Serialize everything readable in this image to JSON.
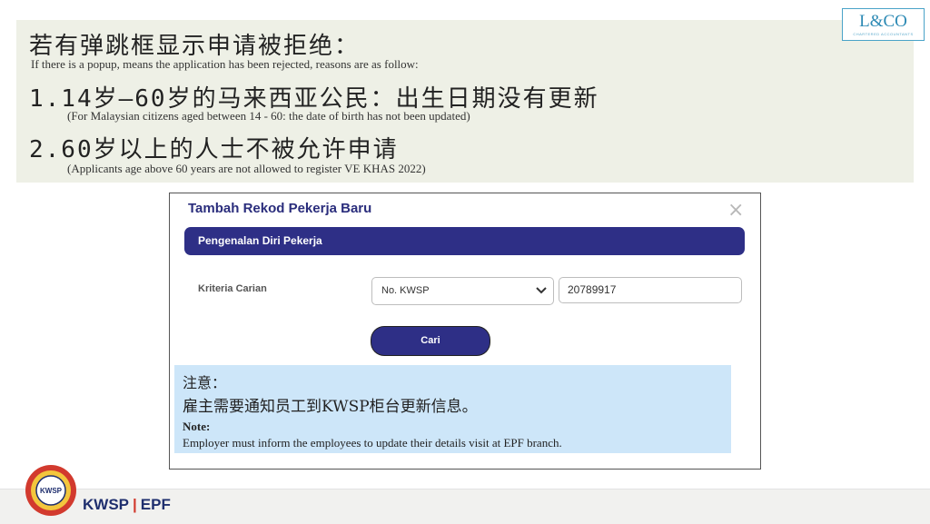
{
  "banner": {
    "title_zh": "若有弹跳框显示申请被拒绝：",
    "title_en": "If there is a popup, means the application has been rejected, reasons are as follow:",
    "reasons": [
      {
        "zh": "1.14岁—60岁的马来西亚公民：出生日期没有更新",
        "en": "(For Malaysian citizens aged between 14 - 60: the date of birth has not been updated)"
      },
      {
        "zh": "2.60岁以上的人士不被允许申请",
        "en": "(Applicants age above 60 years are not allowed to register VE KHAS 2022)"
      }
    ]
  },
  "logo": {
    "text": "L&CO",
    "sub": "CHARTERED ACCOUNTANTS"
  },
  "modal": {
    "title": "Tambah Rekod Pekerja Baru",
    "close": "×",
    "section": "Pengenalan Diri Pekerja",
    "criteria_label": "Kriteria Carian",
    "criteria_value": "No. KWSP",
    "search_value": "20789917",
    "button": "Cari",
    "note": {
      "zh_heading": "注意：",
      "zh_text": "雇主需要通知员工到KWSP柜台更新信息。",
      "en_heading": "Note:",
      "en_text": "Employer must inform the employees to update their details visit at EPF branch."
    }
  },
  "footer": {
    "brand_left": "KWSP",
    "separator": "|",
    "brand_right": "EPF",
    "emblem_text": "KWSP"
  },
  "colors": {
    "accent": "#2e2f86",
    "note_bg": "#cde6f9",
    "banner_bg": "#eef0e6",
    "footer_red": "#d23a2e"
  }
}
